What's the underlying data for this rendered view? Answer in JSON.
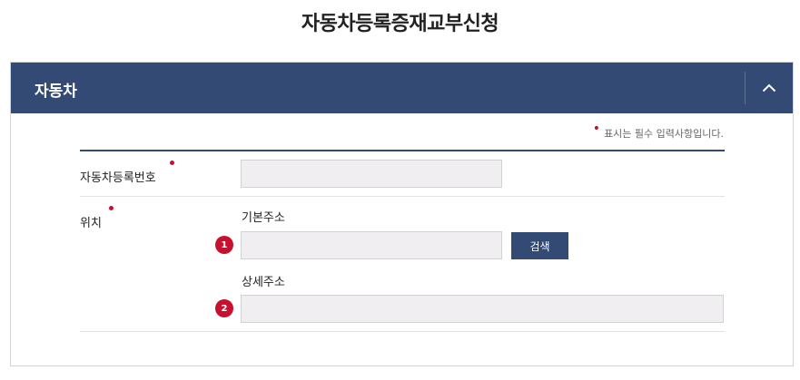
{
  "page": {
    "title": "자동차등록증재교부신청"
  },
  "section": {
    "title": "자동차",
    "required_note": "표시는 필수 입력사항입니다."
  },
  "form": {
    "vehicle_number": {
      "label": "자동차등록번호",
      "value": ""
    },
    "location": {
      "label": "위치",
      "basic_address": {
        "label": "기본주소",
        "value": "",
        "step": "1"
      },
      "search_button": "검색",
      "detail_address": {
        "label": "상세주소",
        "value": "",
        "step": "2"
      }
    }
  },
  "colors": {
    "header": "#334a74",
    "required": "#c8102e",
    "input_bg": "#f1eef1"
  }
}
